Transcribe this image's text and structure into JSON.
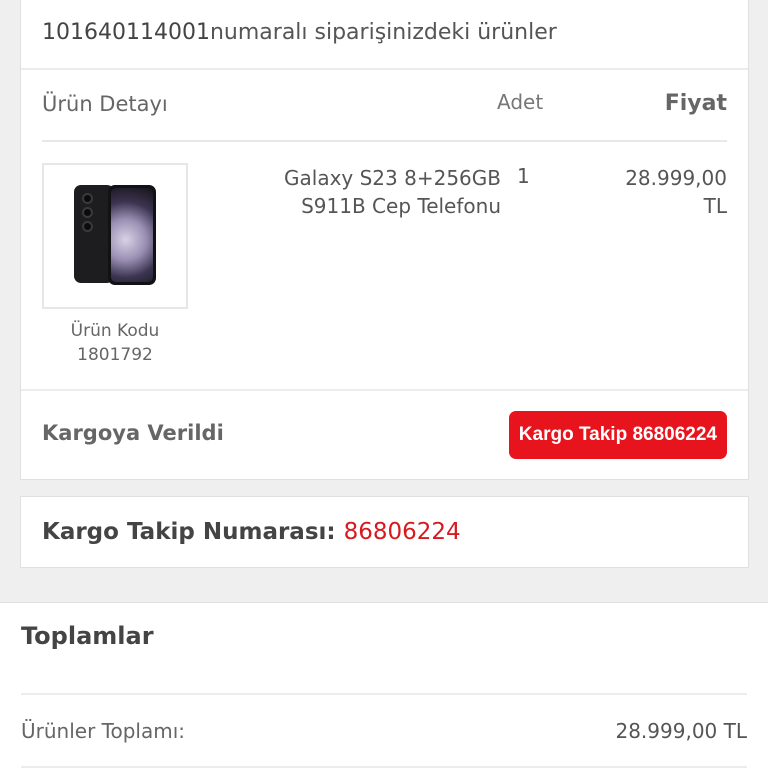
{
  "order": {
    "number": "101640114001",
    "header_suffix": "numaralı siparişinizdeki ürünler",
    "columns": {
      "detail": "Ürün Detayı",
      "qty": "Adet",
      "price": "Fiyat"
    },
    "item": {
      "image": "phone-image",
      "name_line1": "Galaxy S23 8+256GB",
      "name_line2": "S911B Cep Telefonu",
      "quantity": "1",
      "price_line1": "28.999,00",
      "price_line2": "TL",
      "code_label": "Ürün Kodu",
      "code_value": "1801792"
    },
    "status": "Kargoya Verildi",
    "track_button_label": "Kargo Takip 86806224",
    "accent_color": "#e8141d"
  },
  "tracking": {
    "label": "Kargo Takip Numarası:",
    "number": "86806224"
  },
  "totals": {
    "title": "Toplamlar",
    "products_total_label": "Ürünler Toplamı:",
    "products_total_value": "28.999,00 TL"
  }
}
